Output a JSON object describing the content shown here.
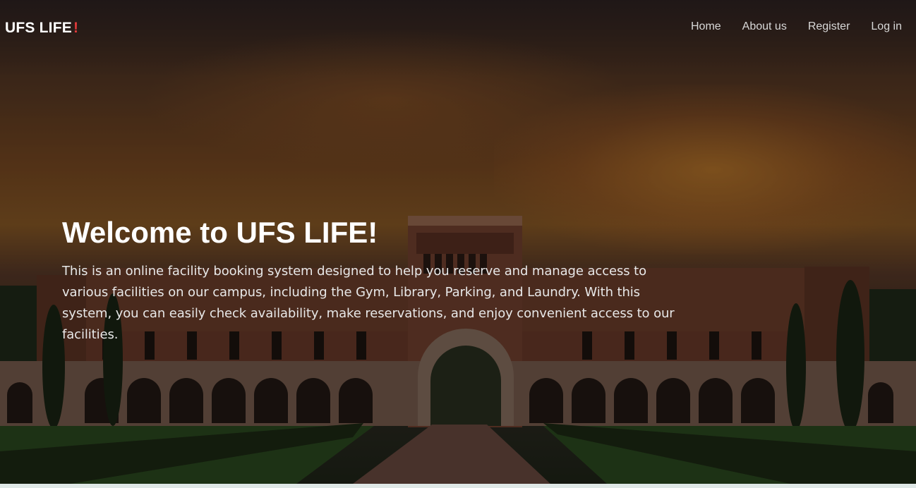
{
  "navbar": {
    "brand": "UFS LIFE",
    "brand_mark": "!",
    "links": [
      "Home",
      "About us",
      "Register",
      "Log in"
    ]
  },
  "hero": {
    "title": "Welcome to UFS LIFE!",
    "description": "This is an online facility booking system designed to help you reserve and manage access to various facilities on our campus, including the Gym, Library, Parking, and Laundry. With this system, you can easily check availability, make reservations, and enjoy convenient access to our facilities."
  },
  "colors": {
    "brand_accent": "#e03a3a",
    "nav_text": "#d8d8d8",
    "headline": "#ffffff"
  }
}
